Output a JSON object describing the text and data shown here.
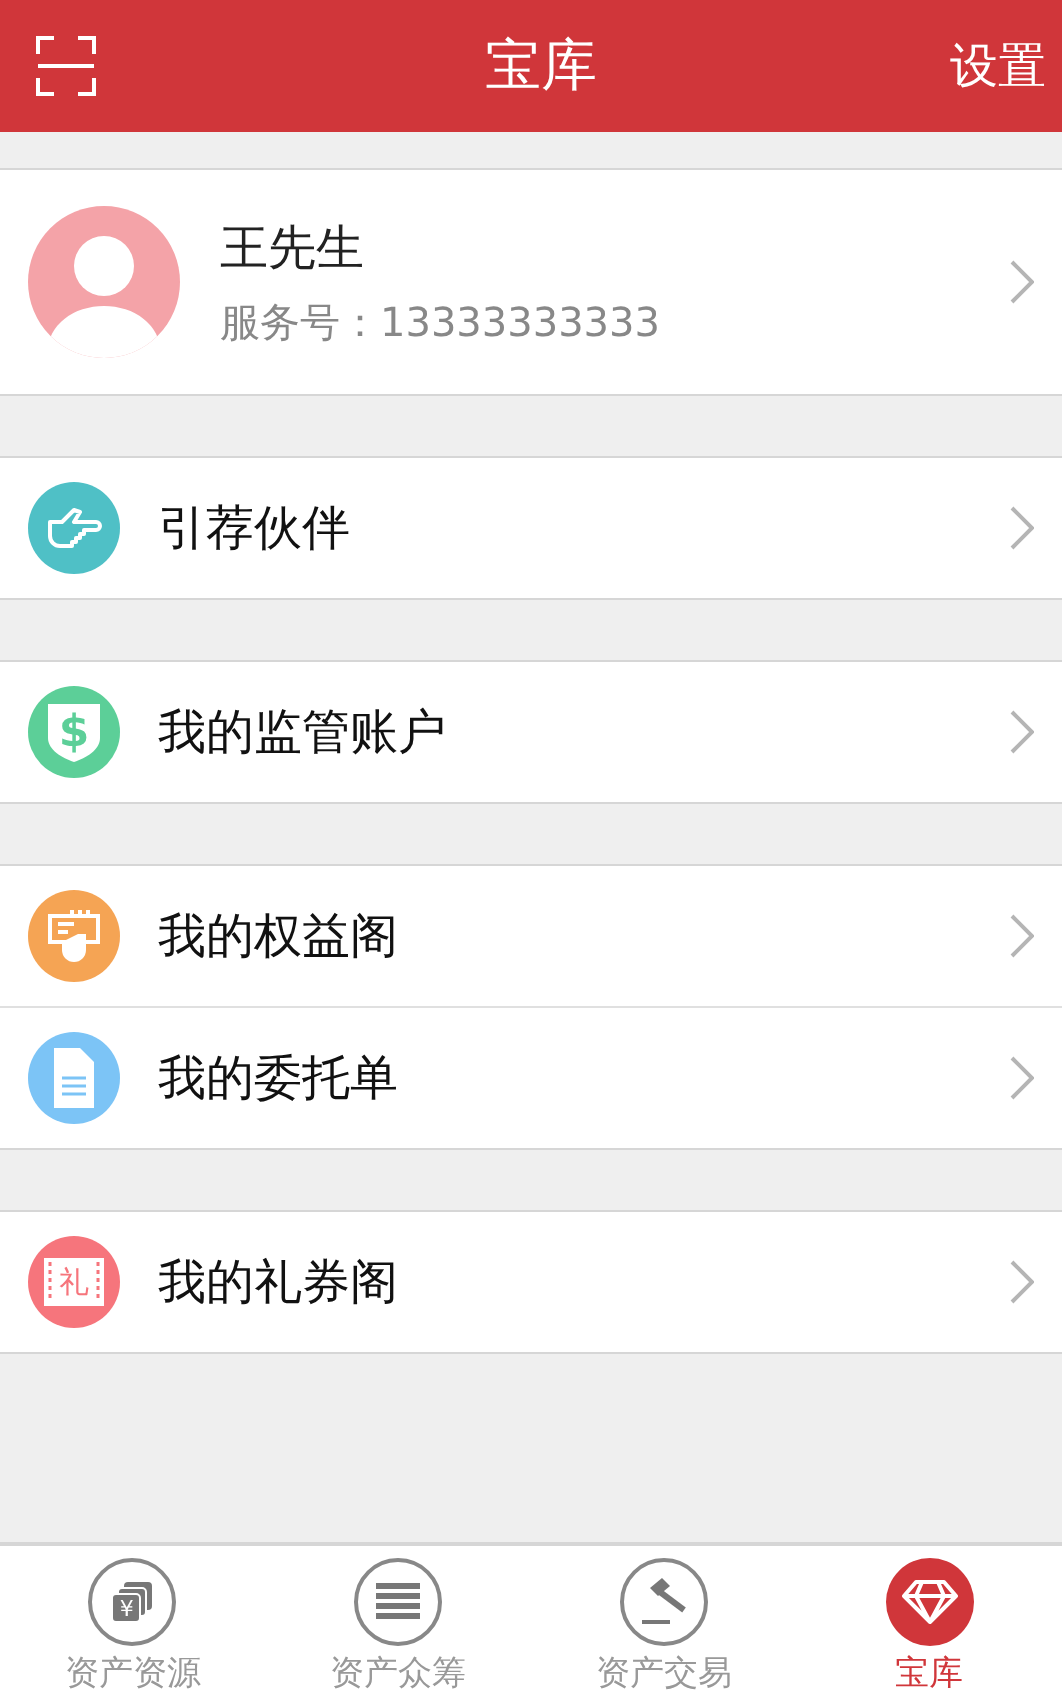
{
  "header": {
    "title": "宝库",
    "action": "设置"
  },
  "profile": {
    "name": "王先生",
    "service_number": "服务号：13333333333"
  },
  "groups": [
    {
      "items": [
        {
          "kind": "hand",
          "label": "引荐伙伴",
          "color": "#4fc0c6"
        }
      ]
    },
    {
      "items": [
        {
          "kind": "shield",
          "label": "我的监管账户",
          "color": "#5ccf98",
          "glyph": "$"
        }
      ]
    },
    {
      "items": [
        {
          "kind": "card",
          "label": "我的权益阁",
          "color": "#f5a454"
        },
        {
          "kind": "document",
          "label": "我的委托单",
          "color": "#7cc4f6"
        }
      ]
    },
    {
      "items": [
        {
          "kind": "ticket",
          "label": "我的礼券阁",
          "color": "#f6757c",
          "glyph": "礼"
        }
      ]
    }
  ],
  "tabs": [
    {
      "kind": "money",
      "label": "资产资源",
      "selected": false,
      "glyph": "¥"
    },
    {
      "kind": "list",
      "label": "资产众筹",
      "selected": false
    },
    {
      "kind": "gavel",
      "label": "资产交易",
      "selected": false
    },
    {
      "kind": "diamond",
      "label": "宝库",
      "selected": true
    }
  ]
}
